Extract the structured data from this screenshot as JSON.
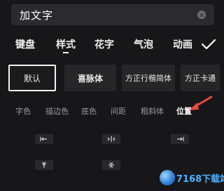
{
  "input": {
    "value": "加文字"
  },
  "tabs": [
    {
      "label": "键盘"
    },
    {
      "label": "样式"
    },
    {
      "label": "花字"
    },
    {
      "label": "气泡"
    },
    {
      "label": "动画"
    }
  ],
  "fonts": [
    {
      "label": "默认"
    },
    {
      "label": "喜脉体"
    },
    {
      "label": "方正行楷简体"
    },
    {
      "label": "方正卡通"
    }
  ],
  "subtabs": [
    {
      "label": "字色"
    },
    {
      "label": "描边色"
    },
    {
      "label": "底色"
    },
    {
      "label": "间距"
    },
    {
      "label": "粗斜体"
    },
    {
      "label": "位置"
    }
  ],
  "watermark": {
    "brand": "7168下载站"
  },
  "colors": {
    "background": "#17171a",
    "arrow": "#e84b3c",
    "card": "#262629"
  }
}
